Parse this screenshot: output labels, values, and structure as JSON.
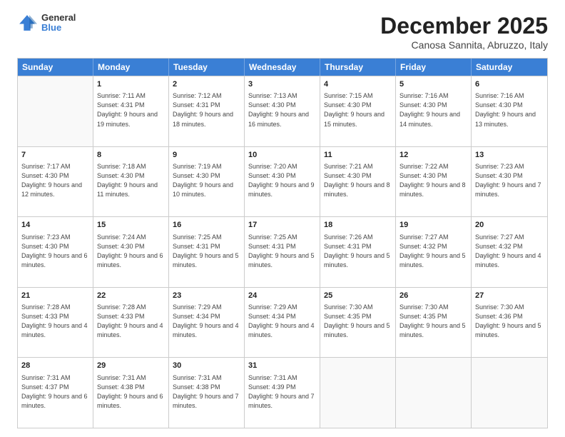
{
  "header": {
    "logo_line1": "General",
    "logo_line2": "Blue",
    "month_title": "December 2025",
    "location": "Canosa Sannita, Abruzzo, Italy"
  },
  "days_of_week": [
    "Sunday",
    "Monday",
    "Tuesday",
    "Wednesday",
    "Thursday",
    "Friday",
    "Saturday"
  ],
  "rows": [
    [
      {
        "day": "",
        "empty": true
      },
      {
        "day": "1",
        "sunrise": "7:11 AM",
        "sunset": "4:31 PM",
        "daylight": "9 hours and 19 minutes."
      },
      {
        "day": "2",
        "sunrise": "7:12 AM",
        "sunset": "4:31 PM",
        "daylight": "9 hours and 18 minutes."
      },
      {
        "day": "3",
        "sunrise": "7:13 AM",
        "sunset": "4:30 PM",
        "daylight": "9 hours and 16 minutes."
      },
      {
        "day": "4",
        "sunrise": "7:15 AM",
        "sunset": "4:30 PM",
        "daylight": "9 hours and 15 minutes."
      },
      {
        "day": "5",
        "sunrise": "7:16 AM",
        "sunset": "4:30 PM",
        "daylight": "9 hours and 14 minutes."
      },
      {
        "day": "6",
        "sunrise": "7:16 AM",
        "sunset": "4:30 PM",
        "daylight": "9 hours and 13 minutes."
      }
    ],
    [
      {
        "day": "7",
        "sunrise": "7:17 AM",
        "sunset": "4:30 PM",
        "daylight": "9 hours and 12 minutes."
      },
      {
        "day": "8",
        "sunrise": "7:18 AM",
        "sunset": "4:30 PM",
        "daylight": "9 hours and 11 minutes."
      },
      {
        "day": "9",
        "sunrise": "7:19 AM",
        "sunset": "4:30 PM",
        "daylight": "9 hours and 10 minutes."
      },
      {
        "day": "10",
        "sunrise": "7:20 AM",
        "sunset": "4:30 PM",
        "daylight": "9 hours and 9 minutes."
      },
      {
        "day": "11",
        "sunrise": "7:21 AM",
        "sunset": "4:30 PM",
        "daylight": "9 hours and 8 minutes."
      },
      {
        "day": "12",
        "sunrise": "7:22 AM",
        "sunset": "4:30 PM",
        "daylight": "9 hours and 8 minutes."
      },
      {
        "day": "13",
        "sunrise": "7:23 AM",
        "sunset": "4:30 PM",
        "daylight": "9 hours and 7 minutes."
      }
    ],
    [
      {
        "day": "14",
        "sunrise": "7:23 AM",
        "sunset": "4:30 PM",
        "daylight": "9 hours and 6 minutes."
      },
      {
        "day": "15",
        "sunrise": "7:24 AM",
        "sunset": "4:30 PM",
        "daylight": "9 hours and 6 minutes."
      },
      {
        "day": "16",
        "sunrise": "7:25 AM",
        "sunset": "4:31 PM",
        "daylight": "9 hours and 5 minutes."
      },
      {
        "day": "17",
        "sunrise": "7:25 AM",
        "sunset": "4:31 PM",
        "daylight": "9 hours and 5 minutes."
      },
      {
        "day": "18",
        "sunrise": "7:26 AM",
        "sunset": "4:31 PM",
        "daylight": "9 hours and 5 minutes."
      },
      {
        "day": "19",
        "sunrise": "7:27 AM",
        "sunset": "4:32 PM",
        "daylight": "9 hours and 5 minutes."
      },
      {
        "day": "20",
        "sunrise": "7:27 AM",
        "sunset": "4:32 PM",
        "daylight": "9 hours and 4 minutes."
      }
    ],
    [
      {
        "day": "21",
        "sunrise": "7:28 AM",
        "sunset": "4:33 PM",
        "daylight": "9 hours and 4 minutes."
      },
      {
        "day": "22",
        "sunrise": "7:28 AM",
        "sunset": "4:33 PM",
        "daylight": "9 hours and 4 minutes."
      },
      {
        "day": "23",
        "sunrise": "7:29 AM",
        "sunset": "4:34 PM",
        "daylight": "9 hours and 4 minutes."
      },
      {
        "day": "24",
        "sunrise": "7:29 AM",
        "sunset": "4:34 PM",
        "daylight": "9 hours and 4 minutes."
      },
      {
        "day": "25",
        "sunrise": "7:30 AM",
        "sunset": "4:35 PM",
        "daylight": "9 hours and 5 minutes."
      },
      {
        "day": "26",
        "sunrise": "7:30 AM",
        "sunset": "4:35 PM",
        "daylight": "9 hours and 5 minutes."
      },
      {
        "day": "27",
        "sunrise": "7:30 AM",
        "sunset": "4:36 PM",
        "daylight": "9 hours and 5 minutes."
      }
    ],
    [
      {
        "day": "28",
        "sunrise": "7:31 AM",
        "sunset": "4:37 PM",
        "daylight": "9 hours and 6 minutes."
      },
      {
        "day": "29",
        "sunrise": "7:31 AM",
        "sunset": "4:38 PM",
        "daylight": "9 hours and 6 minutes."
      },
      {
        "day": "30",
        "sunrise": "7:31 AM",
        "sunset": "4:38 PM",
        "daylight": "9 hours and 7 minutes."
      },
      {
        "day": "31",
        "sunrise": "7:31 AM",
        "sunset": "4:39 PM",
        "daylight": "9 hours and 7 minutes."
      },
      {
        "day": "",
        "empty": true
      },
      {
        "day": "",
        "empty": true
      },
      {
        "day": "",
        "empty": true
      }
    ]
  ],
  "labels": {
    "sunrise": "Sunrise:",
    "sunset": "Sunset:",
    "daylight": "Daylight:"
  }
}
